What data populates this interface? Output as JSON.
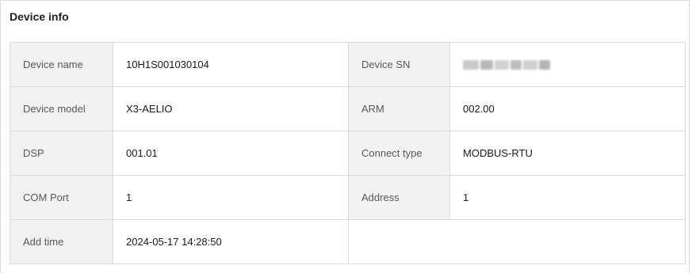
{
  "panel": {
    "title": "Device info"
  },
  "rows": [
    {
      "left": {
        "label": "Device name",
        "value": "10H1S001030104"
      },
      "right": {
        "label": "Device SN",
        "value_redacted": true
      }
    },
    {
      "left": {
        "label": "Device model",
        "value": "X3-AELIO"
      },
      "right": {
        "label": "ARM",
        "value": "002.00"
      }
    },
    {
      "left": {
        "label": "DSP",
        "value": "001.01"
      },
      "right": {
        "label": "Connect type",
        "value": "MODBUS-RTU"
      }
    },
    {
      "left": {
        "label": "COM Port",
        "value": "1"
      },
      "right": {
        "label": "Address",
        "value": "1"
      }
    },
    {
      "left": {
        "label": "Add time",
        "value": "2024-05-17 14:28:50"
      }
    }
  ],
  "colors": {
    "label_background": "#f2f2f2",
    "border": "#dcdcdc",
    "label_text": "#595959",
    "value_text": "#1a1a1a"
  }
}
